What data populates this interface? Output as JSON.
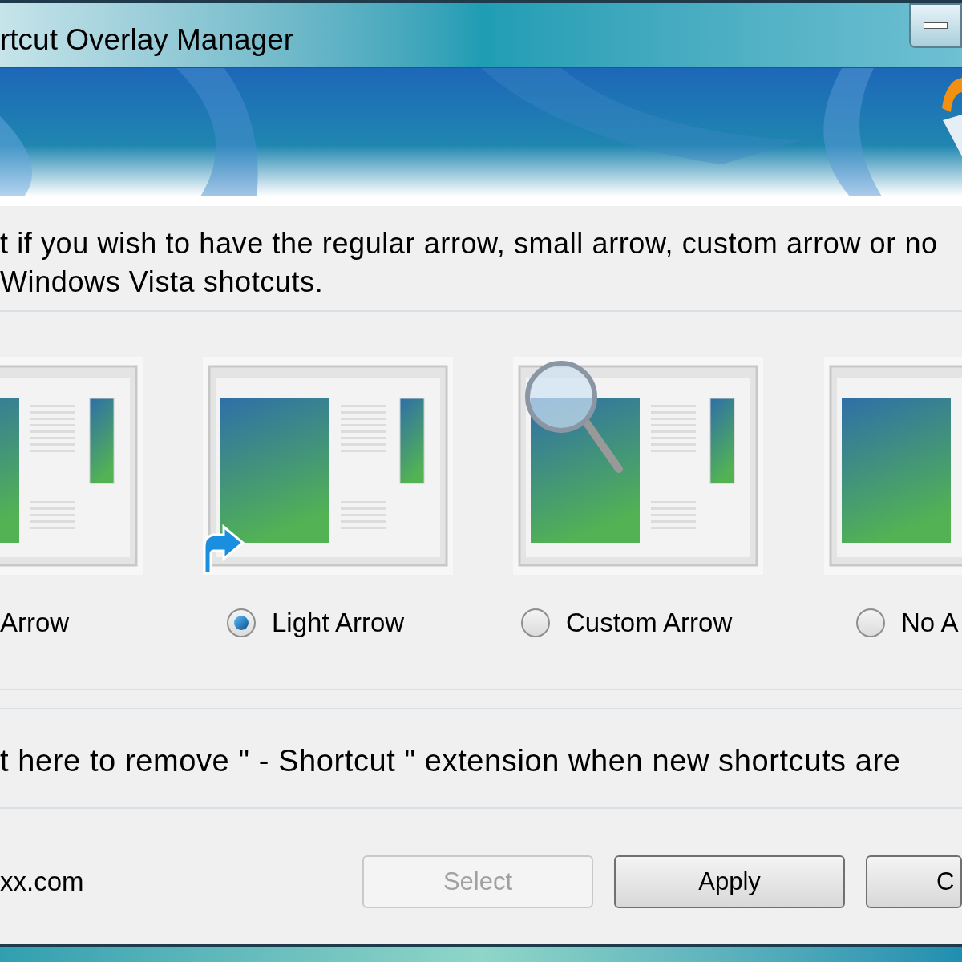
{
  "window": {
    "title": "rtcut Overlay Manager"
  },
  "description": [
    "t if you wish to have the regular arrow, small arrow, custom arrow or no",
    "Windows Vista shotcuts."
  ],
  "options": [
    {
      "label": "Arrow",
      "kind": "plain"
    },
    {
      "label": "Light Arrow",
      "kind": "arrow",
      "selected": true
    },
    {
      "label": "Custom Arrow",
      "kind": "magnifier",
      "selected": false
    },
    {
      "label": "No A",
      "kind": "plain",
      "selected": false
    }
  ],
  "extension_text": "t here to remove \" - Shortcut \" extension when new shortcuts are",
  "link": "xx.com",
  "buttons": [
    {
      "label": "Select",
      "disabled": true
    },
    {
      "label": "Apply",
      "disabled": false
    },
    {
      "label": "C",
      "disabled": false
    }
  ]
}
